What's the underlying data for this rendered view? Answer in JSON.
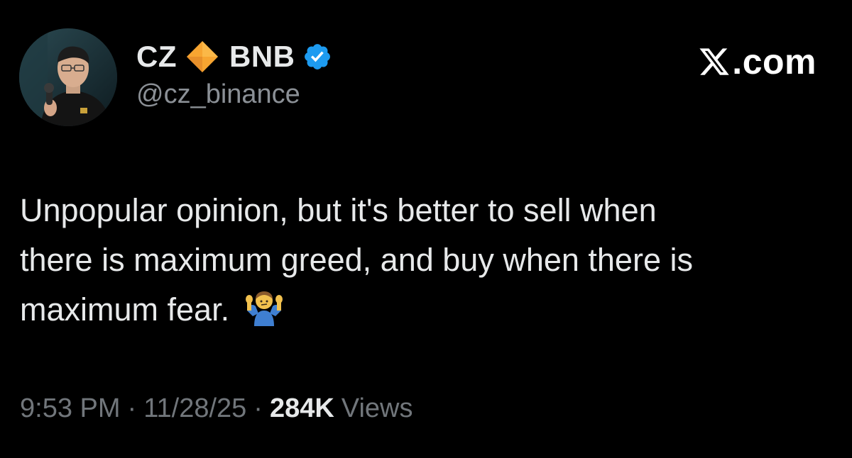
{
  "tweet": {
    "author": {
      "name_first": "CZ",
      "name_second": "BNB",
      "handle": "@cz_binance",
      "badge_icon": "orange-diamond-icon",
      "verified_icon": "verified-badge-icon"
    },
    "brand": {
      "label": ".com",
      "icon": "x-logo-icon"
    },
    "text": "Unpopular opinion, but it's better to sell when\nthere is maximum greed, and buy when there is\nmaximum fear. ",
    "text_emoji": "person-shrugging-icon",
    "meta": {
      "time": "9:53 PM",
      "separator": "·",
      "date": "11/28/25",
      "views_count": "284K",
      "views_label": "Views"
    }
  },
  "colors": {
    "background": "#000000",
    "primary_text": "#e7e9ea",
    "secondary_text": "#71767b",
    "verified_blue": "#1d9bf0",
    "diamond_orange": "#f7a531"
  }
}
